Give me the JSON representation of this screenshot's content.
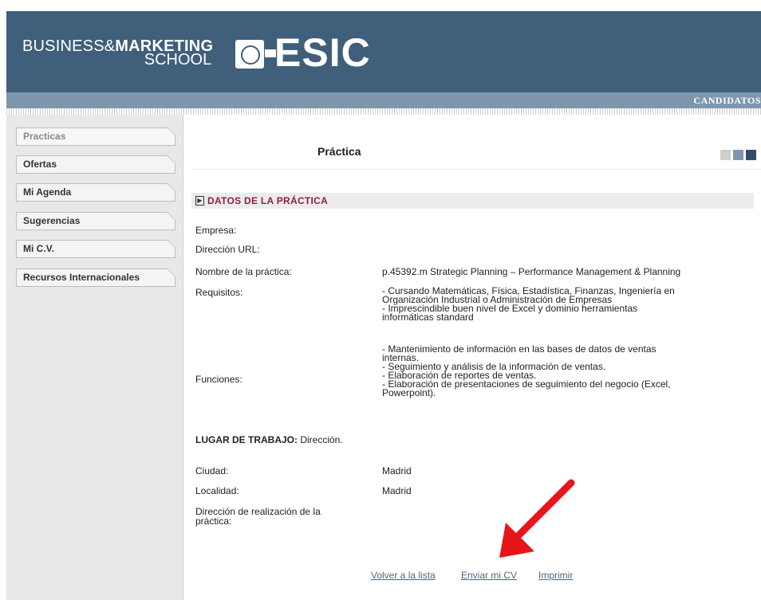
{
  "header": {
    "logo_line1_light": "BUSINESS&",
    "logo_line1_bold": "MARKETING",
    "logo_line2": "SCHOOL",
    "brand": "ESIC",
    "strip_label": "CANDIDATOS",
    "colors": {
      "header_bg": "#3f5f7a",
      "strip_bg": "#7e97ad"
    }
  },
  "sidebar": {
    "items": [
      {
        "label": "Practicas"
      },
      {
        "label": "Ofertas"
      },
      {
        "label": "Mi Agenda"
      },
      {
        "label": "Sugerencias"
      },
      {
        "label": "Mi C.V."
      },
      {
        "label": "Recursos Internacionales"
      }
    ]
  },
  "main": {
    "title": "Práctica",
    "section_title": "DATOS DE LA PRÁCTICA",
    "accent_color": "#8b1f48",
    "fields": {
      "empresa": {
        "label": "Empresa:",
        "value": ""
      },
      "url": {
        "label": "Dirección URL:",
        "value": ""
      },
      "nombre": {
        "label": "Nombre de la práctica:",
        "value": "p.45392.m Strategic Planning – Performance Management & Planning"
      },
      "requisitos": {
        "label": "Requisitos:",
        "lines": [
          "- Cursando Matemáticas, Física, Estadística, Finanzas, Ingeniería en",
          "Organización Industrial o Administración de Empresas",
          "- Imprescindible buen nivel de Excel y dominio herramientas",
          "informáticas standard"
        ]
      },
      "funciones": {
        "label": "Funciones:",
        "lines": [
          "- Mantenimiento de información en las bases de datos de ventas",
          "internas.",
          "- Seguimiento y análisis de la información de ventas.",
          "- Elaboración de reportes de ventas.",
          "- Elaboración de presentaciones de seguimiento del negocio (Excel,",
          "Powerpoint)."
        ]
      }
    },
    "lugar": {
      "label": "LUGAR DE TRABAJO:",
      "value": "Dirección."
    },
    "ubicacion": {
      "ciudad": {
        "label": "Ciudad:",
        "value": "Madrid"
      },
      "localidad": {
        "label": "Localidad:",
        "value": "Madrid"
      },
      "direccion": {
        "label_line1": "Dirección de realización de la",
        "label_line2": "práctica:",
        "value": ""
      }
    },
    "links": {
      "volver": "Volver a la lista",
      "enviar": "Enviar mi CV",
      "imprimir": "Imprimir"
    }
  }
}
